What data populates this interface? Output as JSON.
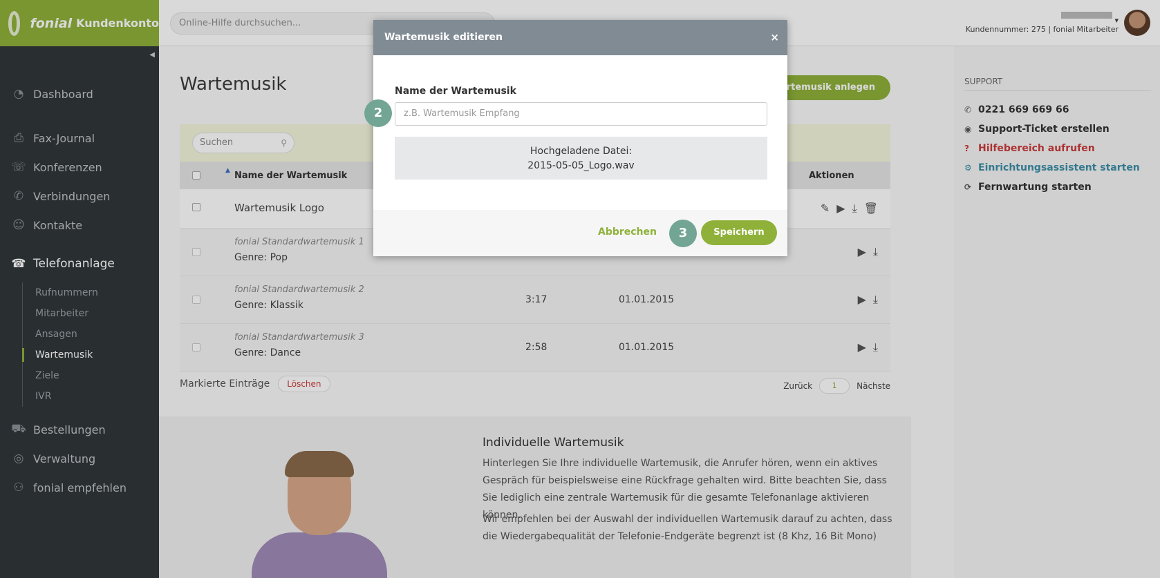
{
  "brand": {
    "name": "fonial",
    "sub": "Kundenkonto"
  },
  "topbar": {
    "search_placeholder": "Online-Hilfe durchsuchen...",
    "customer_info": "Kundennummer: 275 | fonial Mitarbeiter"
  },
  "sidebar": {
    "items": [
      {
        "label": "Dashboard",
        "icon": "dashboard-icon"
      },
      {
        "label": "Fax-Journal",
        "icon": "fax-icon"
      },
      {
        "label": "Konferenzen",
        "icon": "conference-icon"
      },
      {
        "label": "Verbindungen",
        "icon": "phone-icon"
      },
      {
        "label": "Kontakte",
        "icon": "contacts-icon"
      },
      {
        "label": "Telefonanlage",
        "icon": "pbx-icon"
      },
      {
        "label": "Bestellungen",
        "icon": "cart-icon"
      },
      {
        "label": "Verwaltung",
        "icon": "user-icon"
      },
      {
        "label": "fonial empfehlen",
        "icon": "recommend-icon"
      }
    ],
    "subitems": [
      "Rufnummern",
      "Mitarbeiter",
      "Ansagen",
      "Wartemusik",
      "Ziele",
      "IVR"
    ]
  },
  "main": {
    "title": "Wartemusik",
    "create_button": "Wartemusik anlegen",
    "filter_placeholder": "Suchen",
    "columns": {
      "name": "Name der Wartemusik",
      "actions": "Aktionen"
    },
    "rows": [
      {
        "name": "Wartemusik Logo"
      },
      {
        "name": "fonial Standardwartemusik 1",
        "genre": "Genre: Pop"
      },
      {
        "name": "fonial Standardwartemusik 2",
        "genre": "Genre: Klassik",
        "duration": "3:17",
        "date": "01.01.2015"
      },
      {
        "name": "fonial Standardwartemusik 3",
        "genre": "Genre: Dance",
        "duration": "2:58",
        "date": "01.01.2015"
      }
    ],
    "bulk_label": "Markierte Einträge",
    "delete_button": "Löschen",
    "pager": {
      "prev": "Zurück",
      "page": "1",
      "next": "Nächste"
    }
  },
  "info": {
    "title": "Individuelle Wartemusik",
    "p1": "Hinterlegen Sie Ihre individuelle Wartemusik, die Anrufer hören, wenn ein aktives Gespräch für beispielsweise eine Rückfrage gehalten wird. Bitte beachten Sie, dass Sie lediglich eine zentrale Wartemusik für die gesamte Telefonanlage aktivieren können.",
    "p2": "Wir empfehlen bei der Auswahl der individuellen Wartemusik darauf zu achten, dass die Wiedergabequalität der Telefonie-Endgeräte begrenzt ist (8 Khz, 16 Bit Mono)"
  },
  "support": {
    "heading": "SUPPORT",
    "phone": "0221 669 669 66",
    "ticket": "Support-Ticket erstellen",
    "help": "Hilfebereich aufrufen",
    "wizard": "Einrichtungsassistent starten",
    "remote": "Fernwartung starten"
  },
  "modal": {
    "title": "Wartemusik editieren",
    "close": "×",
    "label": "Name der Wartemusik",
    "placeholder": "z.B. Wartemusik Empfang",
    "upload_label": "Hochgeladene Datei:",
    "upload_file": "2015-05-05_Logo.wav",
    "cancel": "Abbrechen",
    "save": "Speichern"
  },
  "steps": {
    "two": "2",
    "three": "3"
  }
}
